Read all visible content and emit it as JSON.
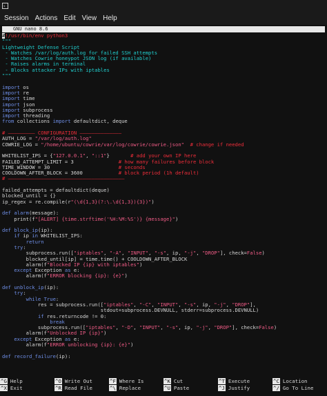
{
  "window": {
    "title_icon": "terminal-icon"
  },
  "menubar": [
    "Session",
    "Actions",
    "Edit",
    "View",
    "Help"
  ],
  "nano": {
    "header": "GNU nano 8.6"
  },
  "code": [
    [
      [
        "shebang",
        "#!/usr/bin/env python3"
      ]
    ],
    [
      [
        "docstr",
        "\"\"\""
      ]
    ],
    [
      [
        "docstr",
        "Lightweight Defense Script"
      ]
    ],
    [
      [
        "docstr",
        " - Watches /var/log/auth.log for failed SSH attempts"
      ]
    ],
    [
      [
        "docstr",
        " - Watches Cowrie honeypot JSON log (if available)"
      ]
    ],
    [
      [
        "docstr",
        " - Raises alarms in terminal"
      ]
    ],
    [
      [
        "docstr",
        " - Blocks attacker IPs with iptables"
      ]
    ],
    [
      [
        "docstr",
        "\"\"\""
      ]
    ],
    [
      [
        "",
        ""
      ]
    ],
    [
      [
        "kw",
        "import"
      ],
      [
        "",
        " os"
      ]
    ],
    [
      [
        "kw",
        "import"
      ],
      [
        "",
        " re"
      ]
    ],
    [
      [
        "kw",
        "import"
      ],
      [
        "",
        " time"
      ]
    ],
    [
      [
        "kw",
        "import"
      ],
      [
        "",
        " json"
      ]
    ],
    [
      [
        "kw",
        "import"
      ],
      [
        "",
        " subprocess"
      ]
    ],
    [
      [
        "kw",
        "import"
      ],
      [
        "",
        " threading"
      ]
    ],
    [
      [
        "kw",
        "from"
      ],
      [
        "",
        " collections "
      ],
      [
        "kw",
        "import"
      ],
      [
        "",
        " defaultdict, deque"
      ]
    ],
    [
      [
        "",
        ""
      ]
    ],
    [
      [
        "cmt",
        "# ————————— CONFIGURATION ——————————————"
      ]
    ],
    [
      [
        "",
        "AUTH_LOG = "
      ],
      [
        "str",
        "\"/var/log/auth.log\""
      ]
    ],
    [
      [
        "",
        "COWRIE_LOG = "
      ],
      [
        "str",
        "\"/home/ubuntu/cowrie/var/log/cowrie/cowrie.json\""
      ],
      [
        "",
        "  "
      ],
      [
        "cmt",
        "# change if needed"
      ]
    ],
    [
      [
        "",
        ""
      ]
    ],
    [
      [
        "",
        "WHITELIST_IPS = {"
      ],
      [
        "str",
        "\"127.0.0.1\""
      ],
      [
        "",
        ", "
      ],
      [
        "str",
        "\"::1\""
      ],
      [
        "",
        "}       "
      ],
      [
        "cmt",
        "# add your own IP here"
      ]
    ],
    [
      [
        "",
        "FAILED_ATTEMPT_LIMIT = 3               "
      ],
      [
        "cmt",
        "# how many failures before block"
      ]
    ],
    [
      [
        "",
        "TIME_WINDOW = 30                       "
      ],
      [
        "cmt",
        "# seconds"
      ]
    ],
    [
      [
        "",
        "COOLDOWN_AFTER_BLOCK = 3600            "
      ],
      [
        "cmt",
        "# block period (1h default)"
      ]
    ],
    [
      [
        "cmt",
        "# ———————————————————————————————————————"
      ]
    ],
    [
      [
        "",
        ""
      ]
    ],
    [
      [
        "",
        "failed_attempts = defaultdict(deque)"
      ]
    ],
    [
      [
        "",
        "blocked_until = {}"
      ]
    ],
    [
      [
        "",
        "ip_regex = re.compile(r"
      ],
      [
        "str",
        "\"(\\d{1,3}(?:\\.\\d{1,3}){3})\""
      ],
      [
        "",
        ")"
      ]
    ],
    [
      [
        "",
        ""
      ]
    ],
    [
      [
        "kw",
        "def"
      ],
      [
        "",
        " "
      ],
      [
        "fnname",
        "alarm"
      ],
      [
        "",
        "(message):"
      ]
    ],
    [
      [
        "",
        "    print(f"
      ],
      [
        "str",
        "\"[ALERT] {time.strftime('%H:%M:%S')} {message}\""
      ],
      [
        "",
        ")"
      ]
    ],
    [
      [
        "",
        ""
      ]
    ],
    [
      [
        "kw",
        "def"
      ],
      [
        "",
        " "
      ],
      [
        "fnname",
        "block_ip"
      ],
      [
        "",
        "(ip):"
      ]
    ],
    [
      [
        "",
        "    "
      ],
      [
        "kw",
        "if"
      ],
      [
        "",
        " ip "
      ],
      [
        "kw",
        "in"
      ],
      [
        "",
        " WHITELIST_IPS:"
      ]
    ],
    [
      [
        "",
        "        "
      ],
      [
        "kw",
        "return"
      ]
    ],
    [
      [
        "",
        "    "
      ],
      [
        "kw",
        "try"
      ],
      [
        "",
        ":"
      ]
    ],
    [
      [
        "",
        "        subprocess.run(["
      ],
      [
        "str",
        "\"iptables\""
      ],
      [
        "",
        ", "
      ],
      [
        "str",
        "\"-A\""
      ],
      [
        "",
        ", "
      ],
      [
        "str",
        "\"INPUT\""
      ],
      [
        "",
        ", "
      ],
      [
        "str",
        "\"-s\""
      ],
      [
        "",
        ", ip, "
      ],
      [
        "str",
        "\"-j\""
      ],
      [
        "",
        ", "
      ],
      [
        "str",
        "\"DROP\""
      ],
      [
        "",
        "], check="
      ],
      [
        "str",
        "False"
      ],
      [
        "",
        ")"
      ]
    ],
    [
      [
        "",
        "        blocked_until[ip] = time.time() + COOLDOWN_AFTER_BLOCK"
      ]
    ],
    [
      [
        "",
        "        alarm(f"
      ],
      [
        "str",
        "\"Blocked IP {ip} with iptables\""
      ],
      [
        "",
        ")"
      ]
    ],
    [
      [
        "",
        "    "
      ],
      [
        "kw",
        "except"
      ],
      [
        "",
        " Exception "
      ],
      [
        "kw",
        "as"
      ],
      [
        "",
        " e:"
      ]
    ],
    [
      [
        "",
        "        alarm(f"
      ],
      [
        "str",
        "\"ERROR blocking {ip}: {e}\""
      ],
      [
        "",
        ")"
      ]
    ],
    [
      [
        "",
        ""
      ]
    ],
    [
      [
        "kw",
        "def"
      ],
      [
        "",
        " "
      ],
      [
        "fnname",
        "unblock_ip"
      ],
      [
        "",
        "(ip):"
      ]
    ],
    [
      [
        "",
        "    "
      ],
      [
        "kw",
        "try"
      ],
      [
        "",
        ":"
      ]
    ],
    [
      [
        "",
        "        "
      ],
      [
        "kw",
        "while"
      ],
      [
        "",
        " "
      ],
      [
        "kw",
        "True"
      ],
      [
        "",
        ":"
      ]
    ],
    [
      [
        "",
        "            res = subprocess.run(["
      ],
      [
        "str",
        "\"iptables\""
      ],
      [
        "",
        ", "
      ],
      [
        "str",
        "\"-C\""
      ],
      [
        "",
        ", "
      ],
      [
        "str",
        "\"INPUT\""
      ],
      [
        "",
        ", "
      ],
      [
        "str",
        "\"-s\""
      ],
      [
        "",
        ", ip, "
      ],
      [
        "str",
        "\"-j\""
      ],
      [
        "",
        ", "
      ],
      [
        "str",
        "\"DROP\""
      ],
      [
        "",
        "],"
      ]
    ],
    [
      [
        "",
        "                                 stdout=subprocess.DEVNULL, stderr=subprocess.DEVNULL)"
      ]
    ],
    [
      [
        "",
        "            "
      ],
      [
        "kw",
        "if"
      ],
      [
        "",
        " res.returncode != 0:"
      ]
    ],
    [
      [
        "",
        "                "
      ],
      [
        "kw",
        "break"
      ]
    ],
    [
      [
        "",
        "            subprocess.run(["
      ],
      [
        "str",
        "\"iptables\""
      ],
      [
        "",
        ", "
      ],
      [
        "str",
        "\"-D\""
      ],
      [
        "",
        ", "
      ],
      [
        "str",
        "\"INPUT\""
      ],
      [
        "",
        ", "
      ],
      [
        "str",
        "\"-s\""
      ],
      [
        "",
        ", ip, "
      ],
      [
        "str",
        "\"-j\""
      ],
      [
        "",
        ", "
      ],
      [
        "str",
        "\"DROP\""
      ],
      [
        "",
        "], check="
      ],
      [
        "str",
        "False"
      ],
      [
        "",
        ")"
      ]
    ],
    [
      [
        "",
        "        alarm(f"
      ],
      [
        "str",
        "\"Unblocked IP {ip}\""
      ],
      [
        "",
        ")"
      ]
    ],
    [
      [
        "",
        "    "
      ],
      [
        "kw",
        "except"
      ],
      [
        "",
        " Exception "
      ],
      [
        "kw",
        "as"
      ],
      [
        "",
        " e:"
      ]
    ],
    [
      [
        "",
        "        alarm(f"
      ],
      [
        "str",
        "\"ERROR unblocking {ip}: {e}\""
      ],
      [
        "",
        ")"
      ]
    ],
    [
      [
        "",
        ""
      ]
    ],
    [
      [
        "kw",
        "def"
      ],
      [
        "",
        " "
      ],
      [
        "fnname",
        "record_failure"
      ],
      [
        "",
        "(ip):"
      ]
    ]
  ],
  "shortcuts": [
    [
      {
        "key": "^G",
        "label": "Help"
      },
      {
        "key": "^O",
        "label": "Write Out"
      },
      {
        "key": "^F",
        "label": "Where Is"
      },
      {
        "key": "^K",
        "label": "Cut"
      },
      {
        "key": "^T",
        "label": "Execute"
      },
      {
        "key": "^C",
        "label": "Location"
      }
    ],
    [
      {
        "key": "^X",
        "label": "Exit"
      },
      {
        "key": "^R",
        "label": "Read File"
      },
      {
        "key": "^\\",
        "label": "Replace"
      },
      {
        "key": "^U",
        "label": "Paste"
      },
      {
        "key": "^J",
        "label": "Justify"
      },
      {
        "key": "^/",
        "label": "Go To Line"
      }
    ]
  ]
}
